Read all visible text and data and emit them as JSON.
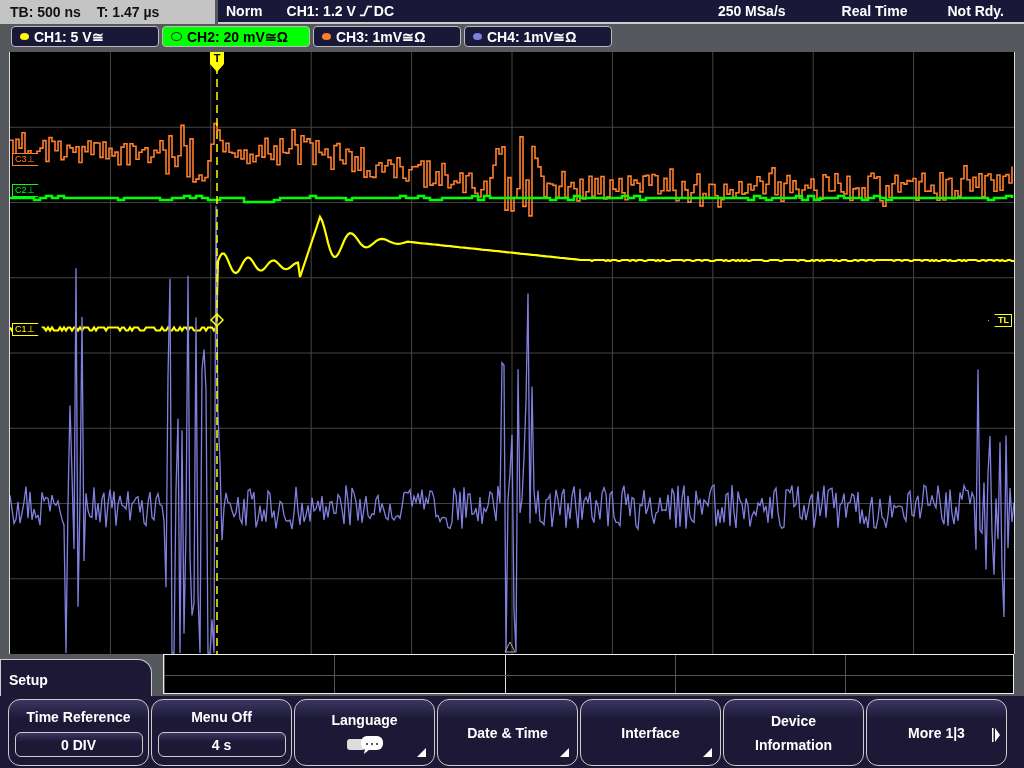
{
  "status_bar": {
    "timebase": "TB: 500 ns",
    "trigger_time": "T: 1.47 µs",
    "mode": "Norm",
    "trigger_level": "CH1: 1.2 V",
    "trigger_rising": true,
    "trigger_coupling": "DC",
    "sample_rate": "250 MSa/s",
    "acquisition": "Real Time",
    "state": "Not Rdy."
  },
  "channels": [
    {
      "label": "CH1: 5 V≅",
      "color": "#ffff00",
      "selected": false
    },
    {
      "label": "CH2: 20 mV≅Ω",
      "color": "#00ff00",
      "selected": true
    },
    {
      "label": "CH3: 1mV≅Ω",
      "color": "#ff7f2a",
      "selected": false
    },
    {
      "label": "CH4: 1mV≅Ω",
      "color": "#8080e0",
      "selected": false
    }
  ],
  "markers": [
    {
      "label": "C3⊥",
      "color": "#ff7f2a"
    },
    {
      "label": "C2⊥",
      "color": "#00ff00"
    },
    {
      "label": "C1⊥",
      "color": "#ffff00"
    }
  ],
  "trigger_marker": {
    "label": "T"
  },
  "trigger_level_marker": {
    "label": "TL"
  },
  "menu": {
    "title": "Setup",
    "softkeys": [
      {
        "label": "Time Reference",
        "value": "0 DIV",
        "kind": "value"
      },
      {
        "label": "Menu Off",
        "value": "4 s",
        "kind": "value"
      },
      {
        "label": "Language",
        "kind": "language"
      },
      {
        "label": "Date & Time",
        "kind": "submenu"
      },
      {
        "label": "Interface",
        "kind": "submenu"
      },
      {
        "label": "Device Information",
        "kind": "plain"
      },
      {
        "label": "More 1|3",
        "kind": "next"
      }
    ]
  }
}
